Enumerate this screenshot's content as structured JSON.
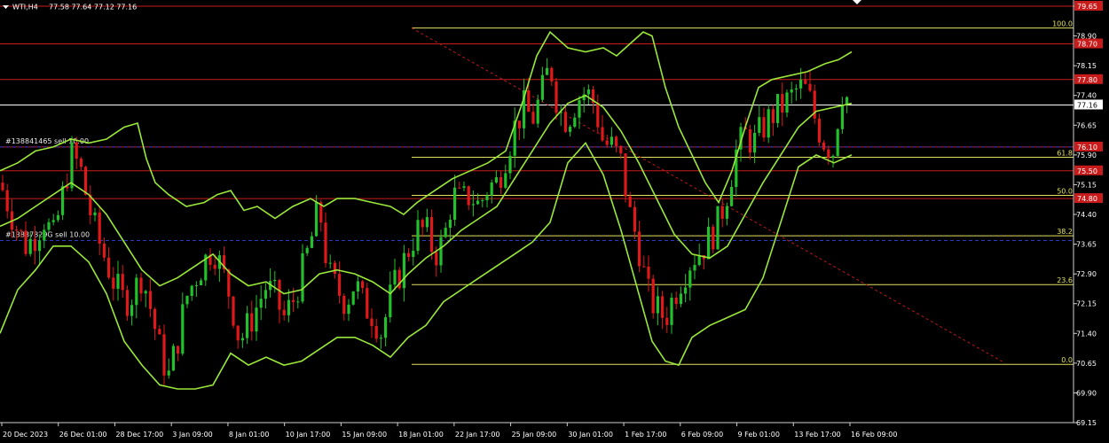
{
  "header": {
    "symbol": "WTI,H4",
    "ohlc": "77.58 77.64 77.12 77.16"
  },
  "colors": {
    "background": "#000000",
    "bull": "#22c02a",
    "bear": "#e01818",
    "band": "#9ae83a",
    "hline": "#c81c1c",
    "fib": "#e3e060",
    "trend": "#c01818",
    "order": "#2a3ac8",
    "price_line": "#ffffff"
  },
  "chart_data": {
    "type": "candlestick",
    "ylim": [
      69.15,
      79.65
    ],
    "y_ticks": [
      "79.65",
      "78.90",
      "78.15",
      "77.40",
      "76.65",
      "75.90",
      "75.15",
      "74.40",
      "73.65",
      "72.90",
      "72.15",
      "71.40",
      "70.65",
      "69.90",
      "69.15"
    ],
    "x_ticks": [
      "20 Dec 2023",
      "26 Dec 01:00",
      "28 Dec 17:00",
      "3 Jan 09:00",
      "8 Jan 01:00",
      "10 Jan 17:00",
      "15 Jan 09:00",
      "18 Jan 01:00",
      "22 Jan 17:00",
      "25 Jan 09:00",
      "30 Jan 01:00",
      "1 Feb 17:00",
      "6 Feb 09:00",
      "9 Feb 01:00",
      "13 Feb 17:00",
      "16 Feb 09:00"
    ],
    "price_labels": [
      {
        "text": "79.65",
        "value": 79.65
      },
      {
        "text": "78.70",
        "value": 78.7
      },
      {
        "text": "77.80",
        "value": 77.8
      },
      {
        "text": "76.10",
        "value": 76.1
      },
      {
        "text": "75.50",
        "value": 75.5
      },
      {
        "text": "74.80",
        "value": 74.8
      }
    ],
    "current_price": {
      "text": "77.16",
      "value": 77.16
    },
    "fib_levels": [
      {
        "label": "100.0",
        "value": 79.1
      },
      {
        "label": "61.8",
        "value": 75.84
      },
      {
        "label": "50.0",
        "value": 74.88
      },
      {
        "label": "38.2",
        "value": 73.86
      },
      {
        "label": "23.6",
        "value": 72.63
      },
      {
        "label": "0.0",
        "value": 70.62
      }
    ],
    "orders": [
      {
        "label": "#138841465 sell 10.00",
        "value": 76.1
      },
      {
        "label": "#13837829G sell 10.00",
        "value": 73.74
      }
    ],
    "close_path": [
      [
        0,
        75.2
      ],
      [
        10,
        74.6
      ],
      [
        20,
        74.0
      ],
      [
        30,
        73.6
      ],
      [
        40,
        73.9
      ],
      [
        50,
        74.3
      ],
      [
        60,
        73.8
      ],
      [
        70,
        74.8
      ],
      [
        80,
        75.9
      ],
      [
        90,
        75.6
      ],
      [
        100,
        74.6
      ],
      [
        110,
        73.8
      ],
      [
        120,
        73.2
      ],
      [
        130,
        72.6
      ],
      [
        140,
        72.2
      ],
      [
        150,
        72.4
      ],
      [
        160,
        72.9
      ],
      [
        170,
        72.0
      ],
      [
        180,
        71.0
      ],
      [
        190,
        70.3
      ],
      [
        200,
        71.2
      ],
      [
        210,
        72.3
      ],
      [
        220,
        72.8
      ],
      [
        230,
        73.2
      ],
      [
        240,
        73.6
      ],
      [
        250,
        73.0
      ],
      [
        260,
        72.3
      ],
      [
        270,
        71.2
      ],
      [
        280,
        71.6
      ],
      [
        290,
        72.1
      ],
      [
        300,
        72.6
      ],
      [
        310,
        72.3
      ],
      [
        320,
        71.8
      ],
      [
        330,
        72.2
      ],
      [
        340,
        72.9
      ],
      [
        350,
        73.7
      ],
      [
        360,
        74.6
      ],
      [
        370,
        72.9
      ],
      [
        380,
        72.5
      ],
      [
        390,
        72.2
      ],
      [
        400,
        72.7
      ],
      [
        410,
        72.1
      ],
      [
        420,
        71.9
      ],
      [
        430,
        71.4
      ],
      [
        440,
        72.3
      ],
      [
        450,
        72.9
      ],
      [
        460,
        73.5
      ],
      [
        470,
        74.0
      ],
      [
        480,
        74.0
      ],
      [
        490,
        73.4
      ],
      [
        500,
        73.7
      ],
      [
        510,
        74.9
      ],
      [
        520,
        74.7
      ],
      [
        530,
        74.9
      ],
      [
        540,
        74.6
      ],
      [
        550,
        75.1
      ],
      [
        560,
        75.2
      ],
      [
        570,
        75.9
      ],
      [
        580,
        76.6
      ],
      [
        590,
        77.1
      ],
      [
        600,
        76.8
      ],
      [
        610,
        77.4
      ],
      [
        620,
        78.2
      ],
      [
        630,
        77.0
      ],
      [
        640,
        76.8
      ],
      [
        650,
        77.3
      ],
      [
        660,
        77.5
      ],
      [
        670,
        77.2
      ],
      [
        680,
        76.2
      ],
      [
        690,
        76.1
      ],
      [
        700,
        75.7
      ],
      [
        710,
        74.4
      ],
      [
        720,
        73.6
      ],
      [
        730,
        72.4
      ],
      [
        740,
        72.0
      ],
      [
        750,
        71.8
      ],
      [
        760,
        72.4
      ],
      [
        770,
        72.9
      ],
      [
        780,
        73.3
      ],
      [
        790,
        73.5
      ],
      [
        800,
        73.8
      ],
      [
        810,
        74.2
      ],
      [
        820,
        75.0
      ],
      [
        830,
        76.0
      ],
      [
        840,
        76.4
      ],
      [
        850,
        76.2
      ],
      [
        860,
        76.6
      ],
      [
        870,
        76.9
      ],
      [
        880,
        77.1
      ],
      [
        890,
        77.3
      ],
      [
        900,
        77.6
      ],
      [
        910,
        77.5
      ],
      [
        920,
        76.7
      ],
      [
        930,
        76.2
      ],
      [
        940,
        76.0
      ],
      [
        945,
        77.0
      ],
      [
        950,
        77.6
      ],
      [
        958,
        77.16
      ]
    ],
    "upper_band": [
      [
        0,
        75.5
      ],
      [
        20,
        75.7
      ],
      [
        40,
        76.0
      ],
      [
        60,
        76.1
      ],
      [
        80,
        76.3
      ],
      [
        100,
        76.2
      ],
      [
        120,
        76.3
      ],
      [
        140,
        76.6
      ],
      [
        155,
        76.7
      ],
      [
        165,
        75.8
      ],
      [
        175,
        75.2
      ],
      [
        190,
        74.9
      ],
      [
        210,
        74.6
      ],
      [
        230,
        74.7
      ],
      [
        245,
        74.9
      ],
      [
        260,
        75.0
      ],
      [
        275,
        74.5
      ],
      [
        290,
        74.6
      ],
      [
        310,
        74.3
      ],
      [
        330,
        74.6
      ],
      [
        350,
        74.8
      ],
      [
        365,
        74.6
      ],
      [
        380,
        74.8
      ],
      [
        400,
        74.8
      ],
      [
        420,
        74.7
      ],
      [
        440,
        74.6
      ],
      [
        455,
        74.4
      ],
      [
        470,
        74.7
      ],
      [
        490,
        75.0
      ],
      [
        510,
        75.3
      ],
      [
        530,
        75.5
      ],
      [
        550,
        75.7
      ],
      [
        570,
        76.0
      ],
      [
        590,
        77.3
      ],
      [
        605,
        78.4
      ],
      [
        620,
        79.0
      ],
      [
        640,
        78.6
      ],
      [
        660,
        78.5
      ],
      [
        680,
        78.6
      ],
      [
        695,
        78.4
      ],
      [
        710,
        78.7
      ],
      [
        725,
        79.0
      ],
      [
        735,
        78.9
      ],
      [
        750,
        77.6
      ],
      [
        765,
        76.6
      ],
      [
        780,
        75.9
      ],
      [
        795,
        75.2
      ],
      [
        810,
        74.7
      ],
      [
        825,
        75.5
      ],
      [
        840,
        76.6
      ],
      [
        855,
        77.6
      ],
      [
        870,
        77.8
      ],
      [
        890,
        77.9
      ],
      [
        910,
        78.0
      ],
      [
        930,
        78.2
      ],
      [
        945,
        78.3
      ],
      [
        960,
        78.5
      ]
    ],
    "middle_band": [
      [
        0,
        74.1
      ],
      [
        20,
        74.3
      ],
      [
        40,
        74.6
      ],
      [
        60,
        74.9
      ],
      [
        80,
        75.2
      ],
      [
        100,
        74.9
      ],
      [
        120,
        74.4
      ],
      [
        140,
        73.7
      ],
      [
        160,
        73.0
      ],
      [
        180,
        72.6
      ],
      [
        200,
        72.8
      ],
      [
        220,
        73.1
      ],
      [
        240,
        73.4
      ],
      [
        260,
        72.9
      ],
      [
        280,
        72.6
      ],
      [
        300,
        72.7
      ],
      [
        320,
        72.4
      ],
      [
        340,
        72.5
      ],
      [
        360,
        72.9
      ],
      [
        380,
        73.0
      ],
      [
        400,
        72.9
      ],
      [
        420,
        72.7
      ],
      [
        440,
        72.4
      ],
      [
        460,
        72.9
      ],
      [
        480,
        73.3
      ],
      [
        500,
        73.6
      ],
      [
        520,
        74.0
      ],
      [
        540,
        74.3
      ],
      [
        560,
        74.6
      ],
      [
        580,
        75.3
      ],
      [
        600,
        76.0
      ],
      [
        620,
        76.7
      ],
      [
        640,
        77.2
      ],
      [
        660,
        77.4
      ],
      [
        680,
        77.1
      ],
      [
        700,
        76.5
      ],
      [
        720,
        75.7
      ],
      [
        740,
        74.8
      ],
      [
        760,
        73.9
      ],
      [
        780,
        73.4
      ],
      [
        800,
        73.3
      ],
      [
        820,
        73.6
      ],
      [
        840,
        74.4
      ],
      [
        860,
        75.2
      ],
      [
        880,
        75.9
      ],
      [
        900,
        76.6
      ],
      [
        920,
        77.0
      ],
      [
        940,
        77.1
      ],
      [
        960,
        77.2
      ]
    ],
    "lower_band": [
      [
        0,
        71.4
      ],
      [
        20,
        72.5
      ],
      [
        40,
        73.0
      ],
      [
        60,
        73.6
      ],
      [
        80,
        73.6
      ],
      [
        100,
        73.2
      ],
      [
        120,
        72.4
      ],
      [
        140,
        71.2
      ],
      [
        160,
        70.6
      ],
      [
        180,
        70.1
      ],
      [
        200,
        70.0
      ],
      [
        220,
        70.0
      ],
      [
        240,
        70.1
      ],
      [
        260,
        70.9
      ],
      [
        280,
        70.6
      ],
      [
        300,
        70.8
      ],
      [
        320,
        70.6
      ],
      [
        340,
        70.7
      ],
      [
        360,
        71.0
      ],
      [
        380,
        71.3
      ],
      [
        400,
        71.3
      ],
      [
        420,
        71.1
      ],
      [
        440,
        70.8
      ],
      [
        460,
        71.3
      ],
      [
        480,
        71.6
      ],
      [
        500,
        72.2
      ],
      [
        520,
        72.5
      ],
      [
        540,
        72.8
      ],
      [
        560,
        73.1
      ],
      [
        580,
        73.4
      ],
      [
        600,
        73.7
      ],
      [
        620,
        74.2
      ],
      [
        640,
        75.7
      ],
      [
        660,
        76.2
      ],
      [
        680,
        75.4
      ],
      [
        700,
        74.0
      ],
      [
        720,
        72.4
      ],
      [
        735,
        71.2
      ],
      [
        750,
        70.7
      ],
      [
        765,
        70.6
      ],
      [
        780,
        71.3
      ],
      [
        800,
        71.6
      ],
      [
        820,
        71.8
      ],
      [
        840,
        72.0
      ],
      [
        860,
        72.8
      ],
      [
        880,
        74.2
      ],
      [
        900,
        75.6
      ],
      [
        920,
        75.9
      ],
      [
        940,
        75.7
      ],
      [
        960,
        75.9
      ]
    ],
    "trendline": {
      "from": [
        464,
        79.1
      ],
      "to": [
        1133,
        70.65
      ]
    }
  }
}
